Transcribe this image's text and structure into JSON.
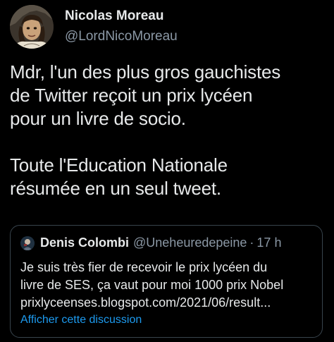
{
  "tweet": {
    "author": {
      "display_name": "Nicolas Moreau",
      "handle": "@LordNicoMoreau",
      "avatar_icon": "profile-avatar"
    },
    "text_lines": [
      "Mdr, l'un des plus gros gauchistes",
      "de Twitter reçoit un prix lycéen",
      "pour un livre de socio.",
      "",
      "Toute l'Education Nationale",
      "résumée en un seul tweet."
    ]
  },
  "quoted_tweet": {
    "author": {
      "display_name": "Denis Colombi",
      "handle": "@Uneheuredepeine",
      "separator": "·",
      "time": "17 h"
    },
    "text_lines": [
      "Je suis très fier de recevoir le prix lycéen du",
      "livre de SES, ça vaut pour moi 1000 prix Nobel",
      "prixlyceenses.blogspot.com/2021/06/result..."
    ],
    "show_thread_label": "Afficher cette discussion"
  },
  "colors": {
    "background": "#000000",
    "primary_text": "#e7e9ea",
    "secondary_text": "#8b98a5",
    "border": "#38444d",
    "link": "#1d9bf0"
  }
}
